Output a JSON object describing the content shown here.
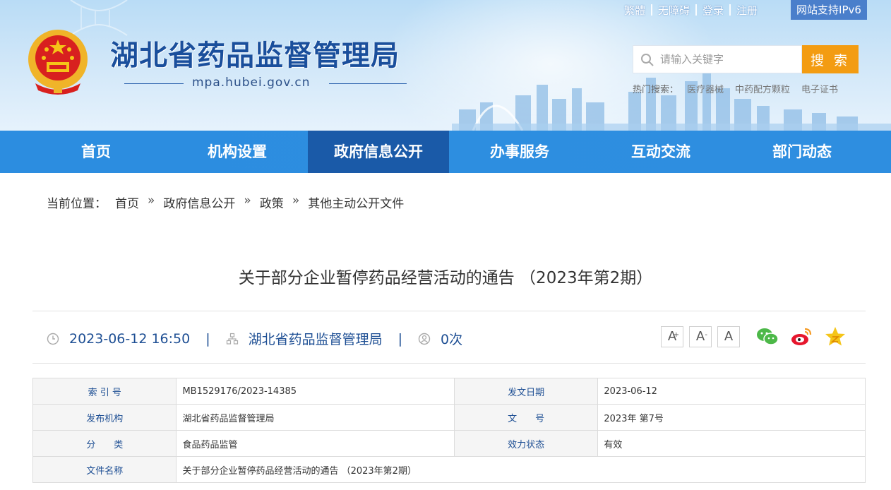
{
  "header": {
    "site_title": "湖北省药品监督管理局",
    "domain": "mpa.hubei.gov.cn",
    "top_links": [
      "繁體",
      "无障碍",
      "登录",
      "注册"
    ],
    "ipv6": "网站支持IPv6",
    "search": {
      "placeholder": "请输入关键字",
      "button": "搜 索"
    },
    "hot_search": {
      "label": "热门搜索：",
      "items": [
        "医疗器械",
        "中药配方颗粒",
        "电子证书"
      ]
    }
  },
  "nav": {
    "items": [
      "首页",
      "机构设置",
      "政府信息公开",
      "办事服务",
      "互动交流",
      "部门动态"
    ],
    "active": "政府信息公开"
  },
  "breadcrumb": {
    "label": "当前位置：",
    "items": [
      "首页",
      "政府信息公开",
      "政策",
      "其他主动公开文件"
    ],
    "separator": "»"
  },
  "article": {
    "title": "关于部分企业暂停药品经营活动的通告 （2023年第2期）",
    "date": "2023-06-12 16:50",
    "publisher": "湖北省药品监督管理局",
    "views": "0次",
    "pipe": "|",
    "font_sizes": [
      "A",
      "A",
      "A"
    ],
    "font_marks": [
      "+",
      "-"
    ]
  },
  "info_table": {
    "rows": [
      [
        "索 引 号",
        "MB1529176/2023-14385",
        "发文日期",
        "2023-06-12"
      ],
      [
        "发布机构",
        "湖北省药品监督管理局",
        "文　　号",
        "2023年 第7号"
      ],
      [
        "分　　类",
        "食品药品监管",
        "效力状态",
        "有效"
      ]
    ],
    "last_row": [
      "文件名称",
      "关于部分企业暂停药品经营活动的通告 （2023年第2期）"
    ]
  },
  "colors": {
    "nav_bg": "#2c8de0",
    "nav_active": "#1a5aa8",
    "title_blue": "#1a4f9c",
    "search_button": "#f39c12",
    "ipv6_bg": "#4a7fcb"
  },
  "icons": [
    "emblem",
    "dna-decoration",
    "skyline",
    "search-icon",
    "clock-icon",
    "org-icon",
    "user-views-icon",
    "wechat-icon",
    "weibo-icon",
    "favorite-star-icon"
  ]
}
